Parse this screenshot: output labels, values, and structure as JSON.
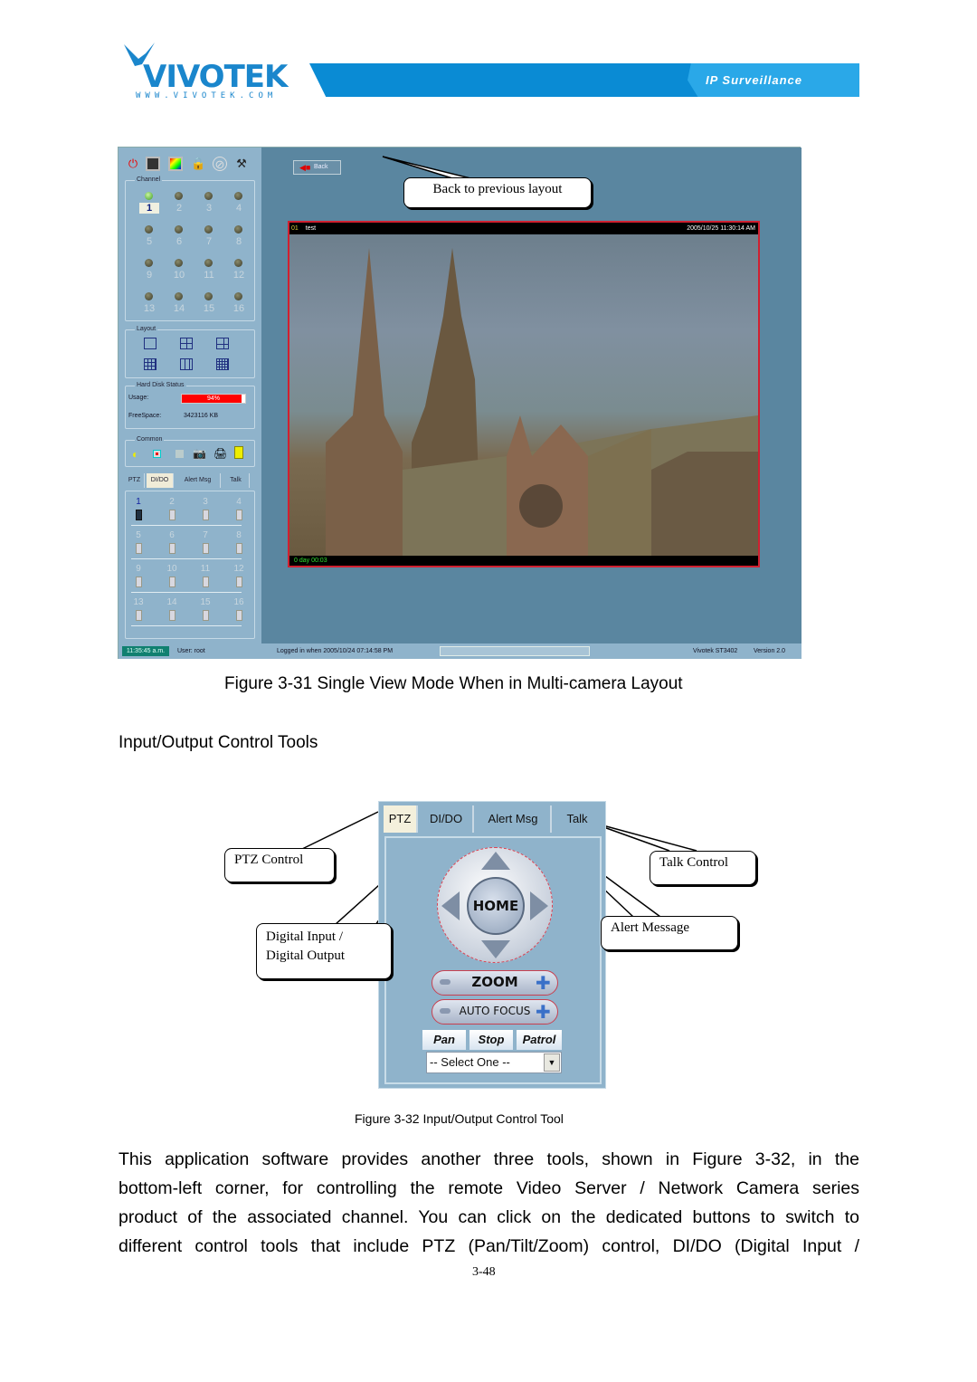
{
  "header": {
    "logo_text": "VIVOTEK",
    "logo_url": "WWW.VIVOTEK.COM",
    "banner_text": "IP Surveillance",
    "brand_color": "#0a8bd4"
  },
  "figure31": {
    "app": {
      "toolbar_icons": [
        "power-icon",
        "monitor-icon",
        "color-monitor-icon",
        "lock-icon",
        "disc-icon",
        "tools-icon"
      ],
      "channel_group": {
        "label": "Channel",
        "channels": [
          "1",
          "2",
          "3",
          "4",
          "5",
          "6",
          "7",
          "8",
          "9",
          "10",
          "11",
          "12",
          "13",
          "14",
          "15",
          "16"
        ],
        "active_channel": "1"
      },
      "layout_group": {
        "label": "Layout"
      },
      "hard_disk": {
        "label": "Hard Disk Status",
        "usage_label": "Usage:",
        "usage_value": "94%",
        "usage_fraction": 0.94,
        "free_label": "FreeSpace:",
        "free_value": "3423116 KB"
      },
      "common_group": {
        "label": "Common"
      },
      "tabs": [
        "PTZ",
        "DI/DO",
        "Alert Msg",
        "Talk"
      ],
      "active_tab": "DI/DO",
      "dido_channels": [
        "1",
        "2",
        "3",
        "4",
        "5",
        "6",
        "7",
        "8",
        "9",
        "10",
        "11",
        "12",
        "13",
        "14",
        "15",
        "16"
      ],
      "back_button": "Back",
      "video": {
        "channel_id": "01",
        "channel_name": "test",
        "timestamp": "2005/10/25 11:30:14 AM",
        "elapsed": "0 day  00:03"
      },
      "status": {
        "clock": "11:35:45 a.m.",
        "user": "User: root",
        "login": "Logged in when  2005/10/24 07:14:58 PM",
        "model": "Vivotek ST3402",
        "version": "Version 2.0"
      }
    },
    "callout_back": "Back to previous layout",
    "caption": "Figure 3-31 Single View Mode When in Multi-camera Layout"
  },
  "section_title": "Input/Output Control Tools",
  "figure32": {
    "tabs": [
      "PTZ",
      "DI/DO",
      "Alert Msg",
      "Talk"
    ],
    "active_tab": "PTZ",
    "home_label": "HOME",
    "zoom_label": "ZOOM",
    "focus_label": "AUTO FOCUS",
    "buttons": [
      "Pan",
      "Stop",
      "Patrol"
    ],
    "select_value": "-- Select One --",
    "callouts": {
      "ptz": "PTZ Control",
      "dido_line1": "Digital Input /",
      "dido_line2": "Digital Output",
      "talk": "Talk Control",
      "alert": "Alert Message"
    },
    "caption": "Figure 3-32 Input/Output Control Tool"
  },
  "body": {
    "lines": [
      "This application software provides another three tools, shown in Figure 3-32, in the",
      "bottom-left corner, for controlling the remote Video Server / Network Camera series",
      "product of the associated channel. You can click on the dedicated buttons to switch to",
      "different control tools that include PTZ (Pan/Tilt/Zoom) control, DI/DO (Digital Input /"
    ]
  },
  "page_number": "3-48"
}
